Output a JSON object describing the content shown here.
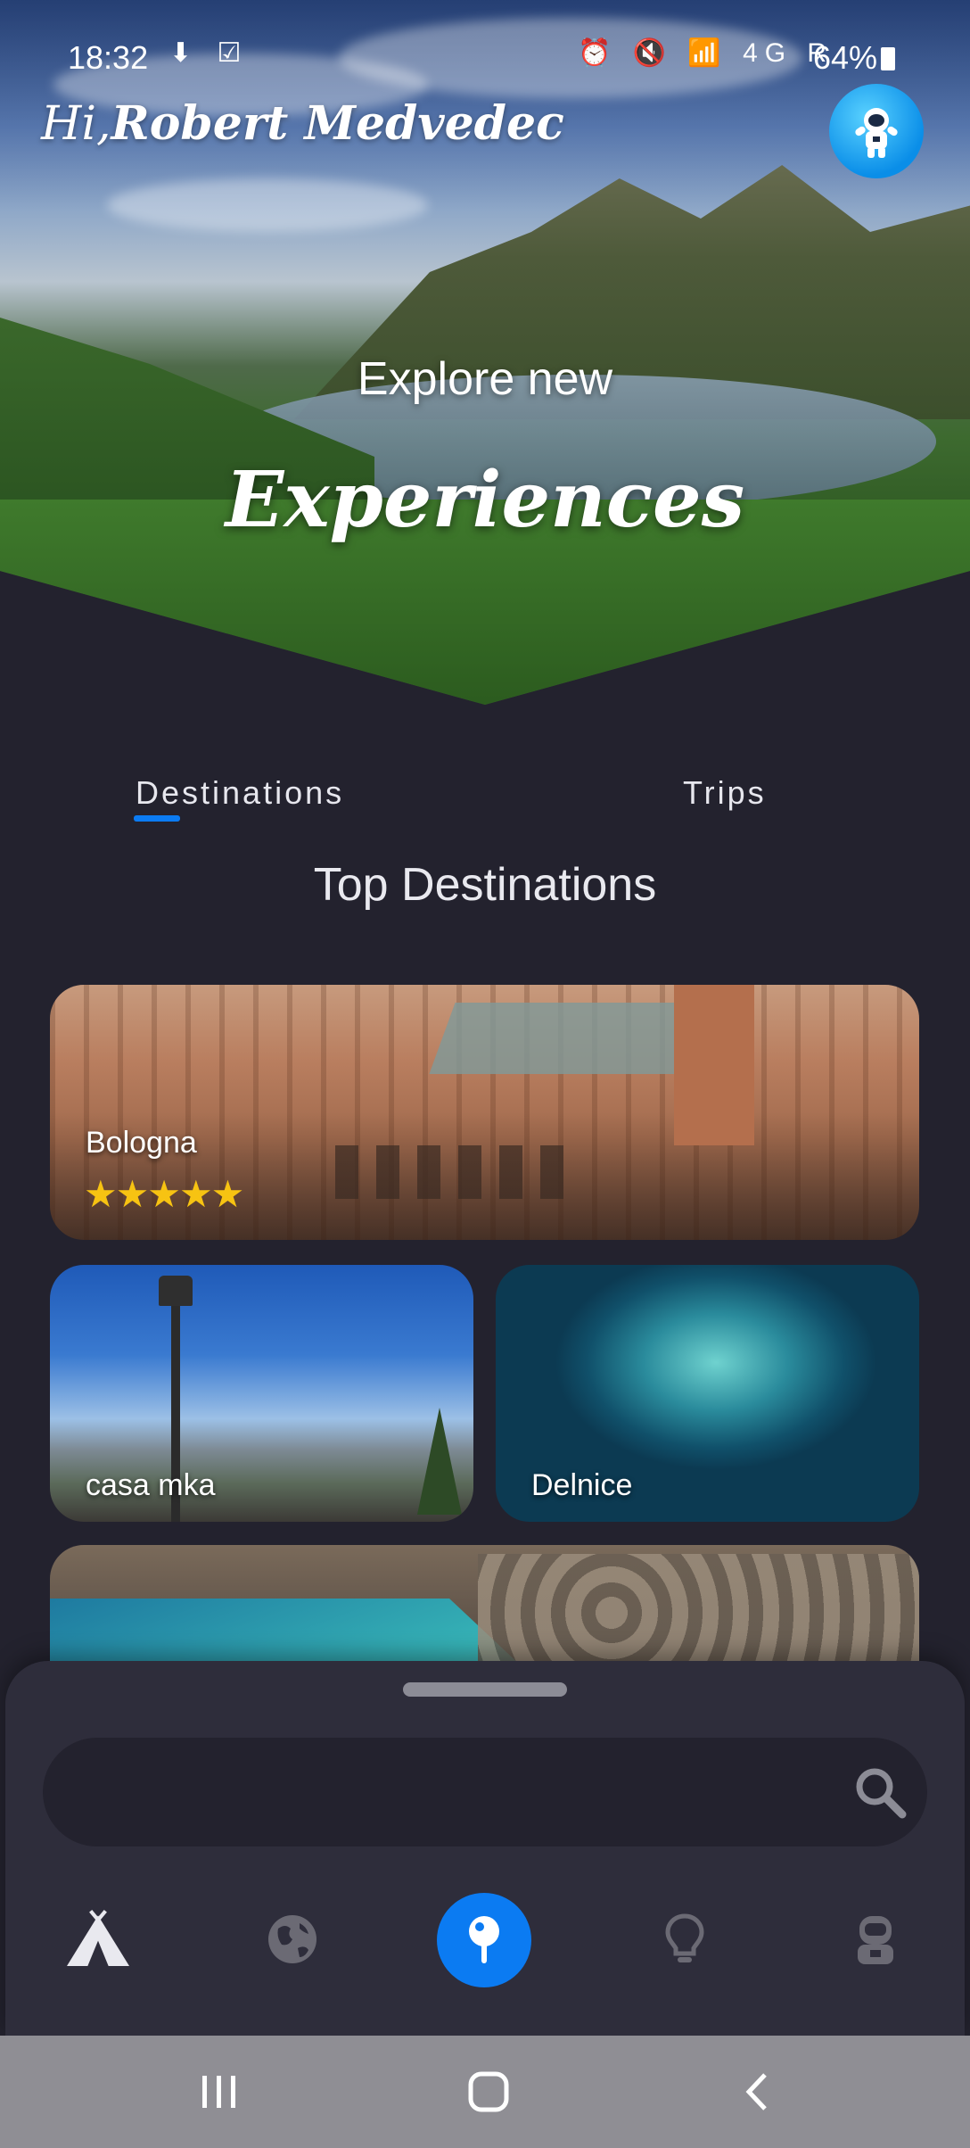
{
  "status_bar": {
    "time": "18:32",
    "left_icons": "⬇ ☑",
    "right_icons": "⏰ 🔇 📶 4G R",
    "battery": "64%"
  },
  "header": {
    "greeting_prefix": "Hi,",
    "user_name": "Robert Medvedec",
    "avatar_icon": "astronaut-icon"
  },
  "hero": {
    "line1": "Explore new",
    "line2": "Experiences"
  },
  "tabs": [
    {
      "label": "Destinations",
      "active": true
    },
    {
      "label": "Trips",
      "active": false
    }
  ],
  "section_title": "Top Destinations",
  "destinations": [
    {
      "name": "Bologna",
      "rating": 5,
      "stars": "★★★★★"
    },
    {
      "name": "casa mka"
    },
    {
      "name": "Delnice"
    },
    {
      "name": ""
    }
  ],
  "search": {
    "placeholder": "",
    "icon": "search-icon"
  },
  "bottom_nav": [
    {
      "icon": "camp-tent-icon",
      "active": false
    },
    {
      "icon": "globe-icon",
      "active": false
    },
    {
      "icon": "map-pin-icon",
      "active": true
    },
    {
      "icon": "lightbulb-icon",
      "active": false
    },
    {
      "icon": "astronaut-profile-icon",
      "active": false
    }
  ],
  "colors": {
    "accent": "#0b7bf2",
    "background": "#23222e",
    "sheet": "#2e2d3b",
    "star": "#f7c312"
  }
}
